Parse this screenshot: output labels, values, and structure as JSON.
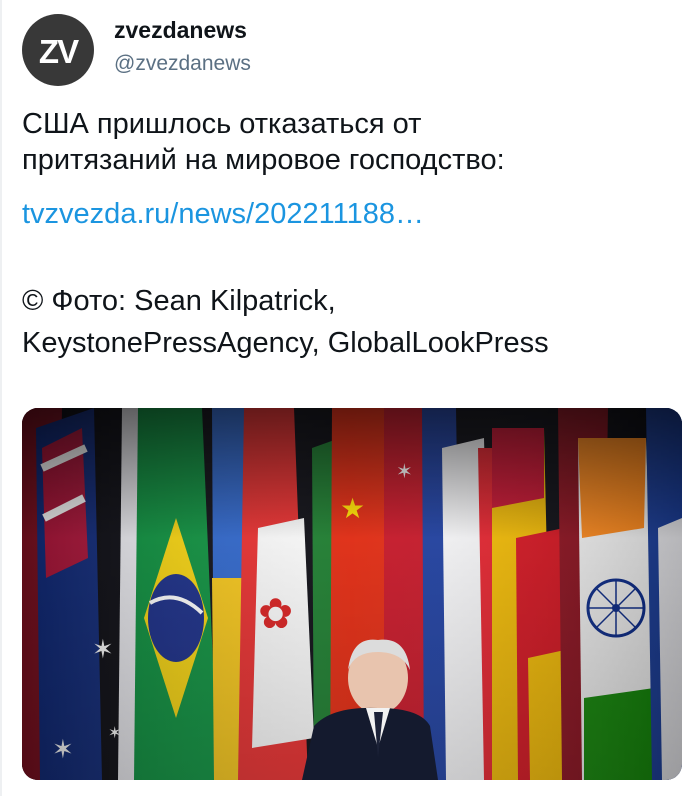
{
  "author": {
    "avatar_text": "ZV",
    "display_name": "zvezdanews",
    "handle": "@zvezdanews",
    "avatar_color": "#383838"
  },
  "tweet": {
    "text_lines": [
      "США пришлось отказаться от",
      "притязаний на мировое господство:"
    ],
    "link": "tvzvezda.ru/news/202211188…",
    "credit_lines": [
      "© Фото: Sean Kilpatrick,",
      "KeystonePressAgency, GlobalLookPress"
    ]
  },
  "media": {
    "icon": "photo-icon"
  },
  "colors": {
    "text": "#0f1419",
    "secondary_text": "#5b7083",
    "link": "#1b95e0",
    "background": "#ffffff"
  }
}
